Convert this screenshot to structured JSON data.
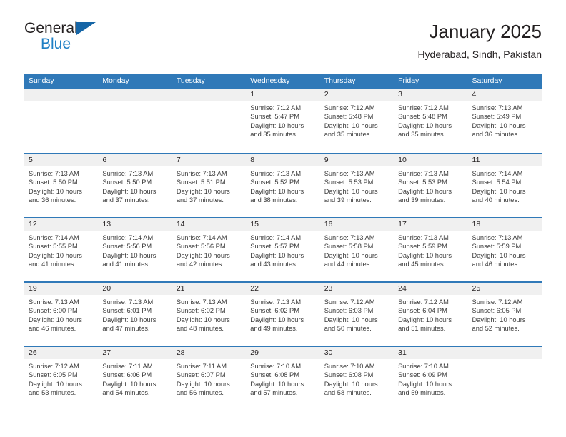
{
  "brand": {
    "name_part1": "General",
    "name_part2": "Blue",
    "mark": "triangle-logo"
  },
  "header": {
    "title": "January 2025",
    "subtitle": "Hyderabad, Sindh, Pakistan"
  },
  "colors": {
    "header_bar": "#3079b8",
    "brand_blue": "#1f7fc4",
    "brand_mark": "#1565a6",
    "day_number_band": "#f0f0f0",
    "text": "#231f20"
  },
  "weekday_headers": [
    "Sunday",
    "Monday",
    "Tuesday",
    "Wednesday",
    "Thursday",
    "Friday",
    "Saturday"
  ],
  "labels": {
    "sunrise": "Sunrise:",
    "sunset": "Sunset:",
    "daylight": "Daylight:"
  },
  "weeks": [
    [
      {
        "day": "",
        "empty": true
      },
      {
        "day": "",
        "empty": true
      },
      {
        "day": "",
        "empty": true
      },
      {
        "day": "1",
        "sunrise": "Sunrise: 7:12 AM",
        "sunset": "Sunset: 5:47 PM",
        "daylight_line1": "Daylight: 10 hours",
        "daylight_line2": "and 35 minutes."
      },
      {
        "day": "2",
        "sunrise": "Sunrise: 7:12 AM",
        "sunset": "Sunset: 5:48 PM",
        "daylight_line1": "Daylight: 10 hours",
        "daylight_line2": "and 35 minutes."
      },
      {
        "day": "3",
        "sunrise": "Sunrise: 7:12 AM",
        "sunset": "Sunset: 5:48 PM",
        "daylight_line1": "Daylight: 10 hours",
        "daylight_line2": "and 35 minutes."
      },
      {
        "day": "4",
        "sunrise": "Sunrise: 7:13 AM",
        "sunset": "Sunset: 5:49 PM",
        "daylight_line1": "Daylight: 10 hours",
        "daylight_line2": "and 36 minutes."
      }
    ],
    [
      {
        "day": "5",
        "sunrise": "Sunrise: 7:13 AM",
        "sunset": "Sunset: 5:50 PM",
        "daylight_line1": "Daylight: 10 hours",
        "daylight_line2": "and 36 minutes."
      },
      {
        "day": "6",
        "sunrise": "Sunrise: 7:13 AM",
        "sunset": "Sunset: 5:50 PM",
        "daylight_line1": "Daylight: 10 hours",
        "daylight_line2": "and 37 minutes."
      },
      {
        "day": "7",
        "sunrise": "Sunrise: 7:13 AM",
        "sunset": "Sunset: 5:51 PM",
        "daylight_line1": "Daylight: 10 hours",
        "daylight_line2": "and 37 minutes."
      },
      {
        "day": "8",
        "sunrise": "Sunrise: 7:13 AM",
        "sunset": "Sunset: 5:52 PM",
        "daylight_line1": "Daylight: 10 hours",
        "daylight_line2": "and 38 minutes."
      },
      {
        "day": "9",
        "sunrise": "Sunrise: 7:13 AM",
        "sunset": "Sunset: 5:53 PM",
        "daylight_line1": "Daylight: 10 hours",
        "daylight_line2": "and 39 minutes."
      },
      {
        "day": "10",
        "sunrise": "Sunrise: 7:13 AM",
        "sunset": "Sunset: 5:53 PM",
        "daylight_line1": "Daylight: 10 hours",
        "daylight_line2": "and 39 minutes."
      },
      {
        "day": "11",
        "sunrise": "Sunrise: 7:14 AM",
        "sunset": "Sunset: 5:54 PM",
        "daylight_line1": "Daylight: 10 hours",
        "daylight_line2": "and 40 minutes."
      }
    ],
    [
      {
        "day": "12",
        "sunrise": "Sunrise: 7:14 AM",
        "sunset": "Sunset: 5:55 PM",
        "daylight_line1": "Daylight: 10 hours",
        "daylight_line2": "and 41 minutes."
      },
      {
        "day": "13",
        "sunrise": "Sunrise: 7:14 AM",
        "sunset": "Sunset: 5:56 PM",
        "daylight_line1": "Daylight: 10 hours",
        "daylight_line2": "and 41 minutes."
      },
      {
        "day": "14",
        "sunrise": "Sunrise: 7:14 AM",
        "sunset": "Sunset: 5:56 PM",
        "daylight_line1": "Daylight: 10 hours",
        "daylight_line2": "and 42 minutes."
      },
      {
        "day": "15",
        "sunrise": "Sunrise: 7:14 AM",
        "sunset": "Sunset: 5:57 PM",
        "daylight_line1": "Daylight: 10 hours",
        "daylight_line2": "and 43 minutes."
      },
      {
        "day": "16",
        "sunrise": "Sunrise: 7:13 AM",
        "sunset": "Sunset: 5:58 PM",
        "daylight_line1": "Daylight: 10 hours",
        "daylight_line2": "and 44 minutes."
      },
      {
        "day": "17",
        "sunrise": "Sunrise: 7:13 AM",
        "sunset": "Sunset: 5:59 PM",
        "daylight_line1": "Daylight: 10 hours",
        "daylight_line2": "and 45 minutes."
      },
      {
        "day": "18",
        "sunrise": "Sunrise: 7:13 AM",
        "sunset": "Sunset: 5:59 PM",
        "daylight_line1": "Daylight: 10 hours",
        "daylight_line2": "and 46 minutes."
      }
    ],
    [
      {
        "day": "19",
        "sunrise": "Sunrise: 7:13 AM",
        "sunset": "Sunset: 6:00 PM",
        "daylight_line1": "Daylight: 10 hours",
        "daylight_line2": "and 46 minutes."
      },
      {
        "day": "20",
        "sunrise": "Sunrise: 7:13 AM",
        "sunset": "Sunset: 6:01 PM",
        "daylight_line1": "Daylight: 10 hours",
        "daylight_line2": "and 47 minutes."
      },
      {
        "day": "21",
        "sunrise": "Sunrise: 7:13 AM",
        "sunset": "Sunset: 6:02 PM",
        "daylight_line1": "Daylight: 10 hours",
        "daylight_line2": "and 48 minutes."
      },
      {
        "day": "22",
        "sunrise": "Sunrise: 7:13 AM",
        "sunset": "Sunset: 6:02 PM",
        "daylight_line1": "Daylight: 10 hours",
        "daylight_line2": "and 49 minutes."
      },
      {
        "day": "23",
        "sunrise": "Sunrise: 7:12 AM",
        "sunset": "Sunset: 6:03 PM",
        "daylight_line1": "Daylight: 10 hours",
        "daylight_line2": "and 50 minutes."
      },
      {
        "day": "24",
        "sunrise": "Sunrise: 7:12 AM",
        "sunset": "Sunset: 6:04 PM",
        "daylight_line1": "Daylight: 10 hours",
        "daylight_line2": "and 51 minutes."
      },
      {
        "day": "25",
        "sunrise": "Sunrise: 7:12 AM",
        "sunset": "Sunset: 6:05 PM",
        "daylight_line1": "Daylight: 10 hours",
        "daylight_line2": "and 52 minutes."
      }
    ],
    [
      {
        "day": "26",
        "sunrise": "Sunrise: 7:12 AM",
        "sunset": "Sunset: 6:05 PM",
        "daylight_line1": "Daylight: 10 hours",
        "daylight_line2": "and 53 minutes."
      },
      {
        "day": "27",
        "sunrise": "Sunrise: 7:11 AM",
        "sunset": "Sunset: 6:06 PM",
        "daylight_line1": "Daylight: 10 hours",
        "daylight_line2": "and 54 minutes."
      },
      {
        "day": "28",
        "sunrise": "Sunrise: 7:11 AM",
        "sunset": "Sunset: 6:07 PM",
        "daylight_line1": "Daylight: 10 hours",
        "daylight_line2": "and 56 minutes."
      },
      {
        "day": "29",
        "sunrise": "Sunrise: 7:10 AM",
        "sunset": "Sunset: 6:08 PM",
        "daylight_line1": "Daylight: 10 hours",
        "daylight_line2": "and 57 minutes."
      },
      {
        "day": "30",
        "sunrise": "Sunrise: 7:10 AM",
        "sunset": "Sunset: 6:08 PM",
        "daylight_line1": "Daylight: 10 hours",
        "daylight_line2": "and 58 minutes."
      },
      {
        "day": "31",
        "sunrise": "Sunrise: 7:10 AM",
        "sunset": "Sunset: 6:09 PM",
        "daylight_line1": "Daylight: 10 hours",
        "daylight_line2": "and 59 minutes."
      },
      {
        "day": "",
        "empty": true
      }
    ]
  ]
}
